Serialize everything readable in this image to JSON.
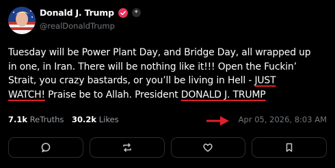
{
  "author": {
    "display_name": "Donald J. Trump",
    "handle": "@realDonaldTrump",
    "avatar_icon": "avatar-flag-portrait",
    "verified_icon": "verified-badge-icon",
    "more_icon": "plus-dot-icon"
  },
  "post": {
    "lines": [
      {
        "segments": [
          {
            "text": "Tuesday will be Power Plant Day, and Bridge Day, all wrapped up",
            "underline": false
          }
        ]
      },
      {
        "segments": [
          {
            "text": "in one, in Iran. There will be nothing like it!!! Open the Fuckin’",
            "underline": false
          }
        ]
      },
      {
        "segments": [
          {
            "text": "Strait, you crazy bastards, or you’ll be living in Hell - ",
            "underline": false
          },
          {
            "text": "JUST",
            "underline": true
          }
        ]
      },
      {
        "segments": [
          {
            "text": "WATCH!",
            "underline": true
          },
          {
            "text": " Praise be to Allah. President ",
            "underline": false
          },
          {
            "text": "DONALD J. TRUMP",
            "underline": true
          }
        ]
      }
    ]
  },
  "stats": {
    "retruths_count": "7.1k",
    "retruths_label": "ReTruths",
    "likes_count": "30.2k",
    "likes_label": "Likes",
    "timestamp": "Apr 05, 2026, 8:03 AM"
  },
  "annotation": {
    "arrow_color": "#e0202a",
    "underline_color": "#e0202a"
  },
  "actions": [
    {
      "name": "reply-button",
      "icon": "speech-bubble-icon"
    },
    {
      "name": "retruth-button",
      "icon": "repost-icon"
    },
    {
      "name": "like-button",
      "icon": "heart-icon"
    },
    {
      "name": "bookmark-button",
      "icon": "bookmark-icon"
    }
  ],
  "colors": {
    "background": "#000000",
    "text": "#ffffff",
    "muted": "#71767b",
    "verified": "#e8325b",
    "button_border": "#2a2d31"
  }
}
